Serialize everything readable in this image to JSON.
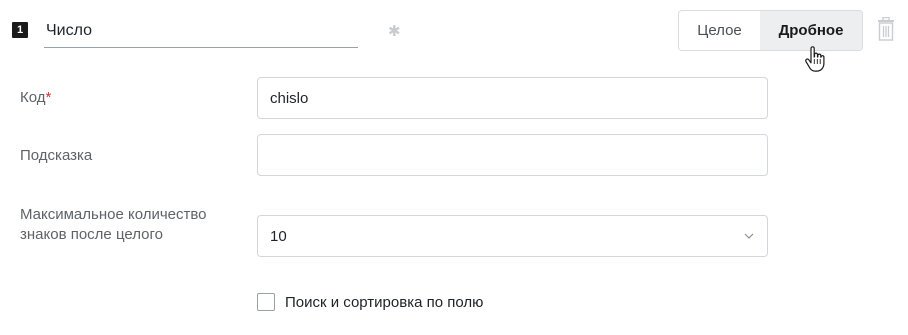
{
  "header": {
    "index": "1",
    "name_value": "Число",
    "type_toggle": {
      "options": [
        "Целое",
        "Дробное"
      ],
      "selected": "Дробное"
    }
  },
  "form": {
    "code": {
      "label": "Код",
      "required_mark": "*",
      "value": "chislo"
    },
    "hint": {
      "label": "Подсказка",
      "value": ""
    },
    "max_digits": {
      "label": "Максимальное количество знаков после целого",
      "value": "10"
    },
    "search_sort": {
      "label": "Поиск и сортировка по полю",
      "checked": false
    }
  },
  "icons": {
    "required": "asterisk-icon",
    "delete": "trash-icon",
    "dropdown": "chevron-down-icon",
    "cursor": "hand-pointer-icon"
  },
  "colors": {
    "required_mark": "#d93025",
    "selected_segment_bg": "#eceef0",
    "border": "#d3d7db"
  }
}
